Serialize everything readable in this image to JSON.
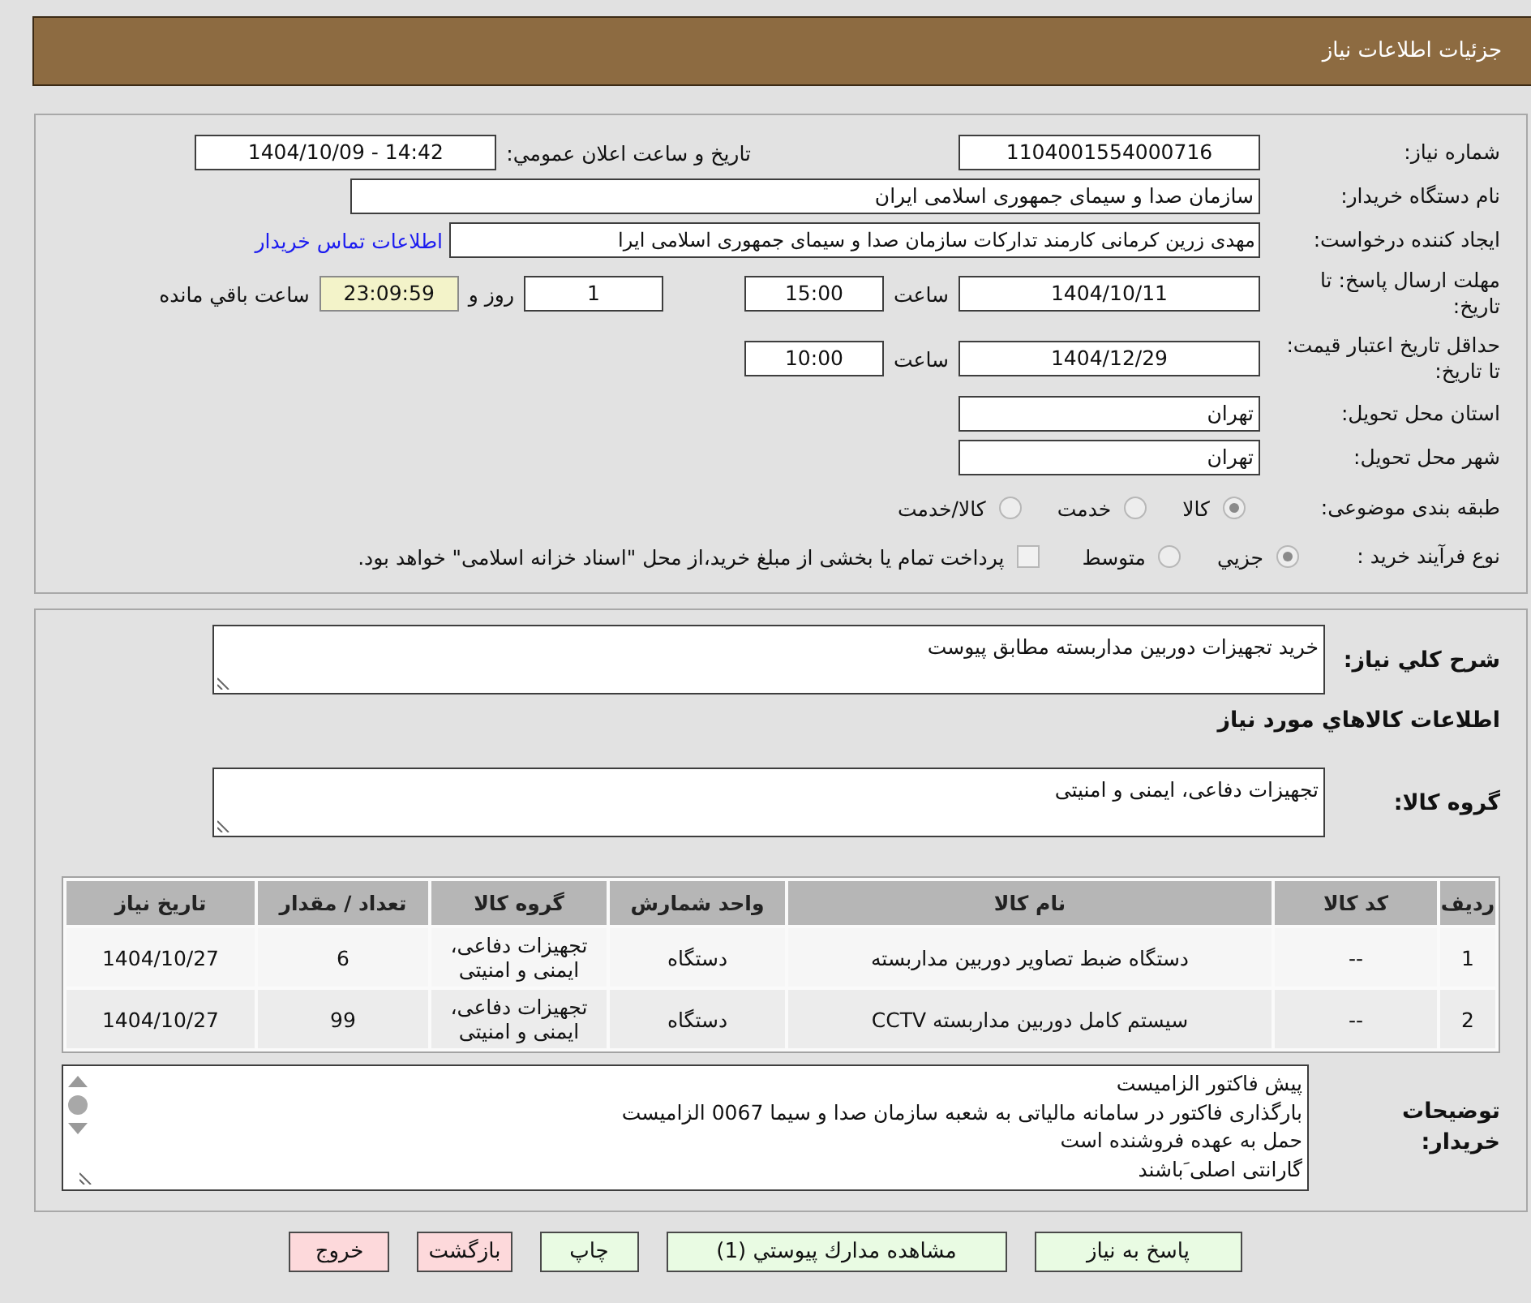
{
  "header": {
    "title": "جزئیات اطلاعات نیاز"
  },
  "details": {
    "need_number": {
      "label": "شماره نیاز:",
      "value": "1104001554000716"
    },
    "announce_time": {
      "label": "تاريخ و ساعت اعلان عمومي:",
      "value": "1404/10/09 - 14:42"
    },
    "buyer_org": {
      "label": "نام دستگاه خریدار:",
      "value": "سازمان صدا و سیمای جمهوری اسلامی ایران"
    },
    "requester": {
      "label": "ایجاد کننده درخواست:",
      "value": "مهدی زرین کرمانی کارمند تدارکات سازمان صدا و سیمای جمهوری اسلامی ایرا",
      "link": "اطلاعات تماس خریدار"
    },
    "reply_deadline": {
      "label": "مهلت ارسال پاسخ: تا تاریخ:",
      "date": "1404/10/11",
      "time_label": "ساعت",
      "time": "15:00",
      "days": "1",
      "days_label": "روز و",
      "remaining": "23:09:59",
      "remaining_label": "ساعت باقي مانده"
    },
    "price_validity": {
      "label": "حداقل تاریخ اعتبار قیمت: تا تاریخ:",
      "date": "1404/12/29",
      "time_label": "ساعت",
      "time": "10:00"
    },
    "province": {
      "label": "استان محل تحویل:",
      "value": "تهران"
    },
    "city": {
      "label": "شهر محل تحویل:",
      "value": "تهران"
    },
    "category": {
      "label": "طبقه بندی موضوعی:",
      "options": [
        {
          "label": "کالا",
          "selected": true
        },
        {
          "label": "خدمت",
          "selected": false
        },
        {
          "label": "کالا/خدمت",
          "selected": false
        }
      ]
    },
    "process": {
      "label": "نوع فرآیند خرید :",
      "options": [
        {
          "label": "جزيي",
          "selected": true
        },
        {
          "label": "متوسط",
          "selected": false
        }
      ],
      "treasury": {
        "label": "پرداخت تمام یا بخشی از مبلغ خرید،از محل \"اسناد خزانه اسلامی\" خواهد بود.",
        "checked": false
      }
    }
  },
  "request": {
    "description": {
      "label": "شرح کلي نیاز:",
      "value": "خرید تجهیزات دوربین مداربسته مطابق پیوست"
    },
    "goods_title": "اطلاعات کالاهاي مورد نیاز",
    "goods_group": {
      "label": "گروه کالا:",
      "value": "تجهیزات دفاعی، ایمنی و امنیتی"
    },
    "table": {
      "columns": [
        "ردیف",
        "کد کالا",
        "نام کالا",
        "واحد شمارش",
        "گروه کالا",
        "تعداد / مقدار",
        "تاریخ نیاز"
      ],
      "rows": [
        [
          "1",
          "--",
          "دستگاه ضبط تصاویر دوربین مداربسته",
          "دستگاه",
          "تجهیزات دفاعی، ایمنی و امنیتی",
          "6",
          "1404/10/27"
        ],
        [
          "2",
          "--",
          "سیستم کامل دوربین مداربسته CCTV",
          "دستگاه",
          "تجهیزات دفاعی، ایمنی و امنیتی",
          "99",
          "1404/10/27"
        ]
      ]
    },
    "buyer_notes": {
      "label": "توضیحات خریدار:",
      "text": "پیش فاکتور الزامیست\nبارگذاری فاکتور در سامانه مالیاتی به شعبه سازمان صدا و سیما 0067 الزامیست\nحمل به عهده فروشنده است\nگارانتی اصلی َباشند"
    }
  },
  "buttons": [
    {
      "label": "پاسخ به نیاز",
      "kind": "primary"
    },
    {
      "label": "مشاهده مدارك پیوستي (1)",
      "kind": "primary"
    },
    {
      "label": "چاپ",
      "kind": "primary"
    },
    {
      "label": "بازگشت",
      "kind": "cancel"
    },
    {
      "label": "خروج",
      "kind": "cancel"
    }
  ]
}
